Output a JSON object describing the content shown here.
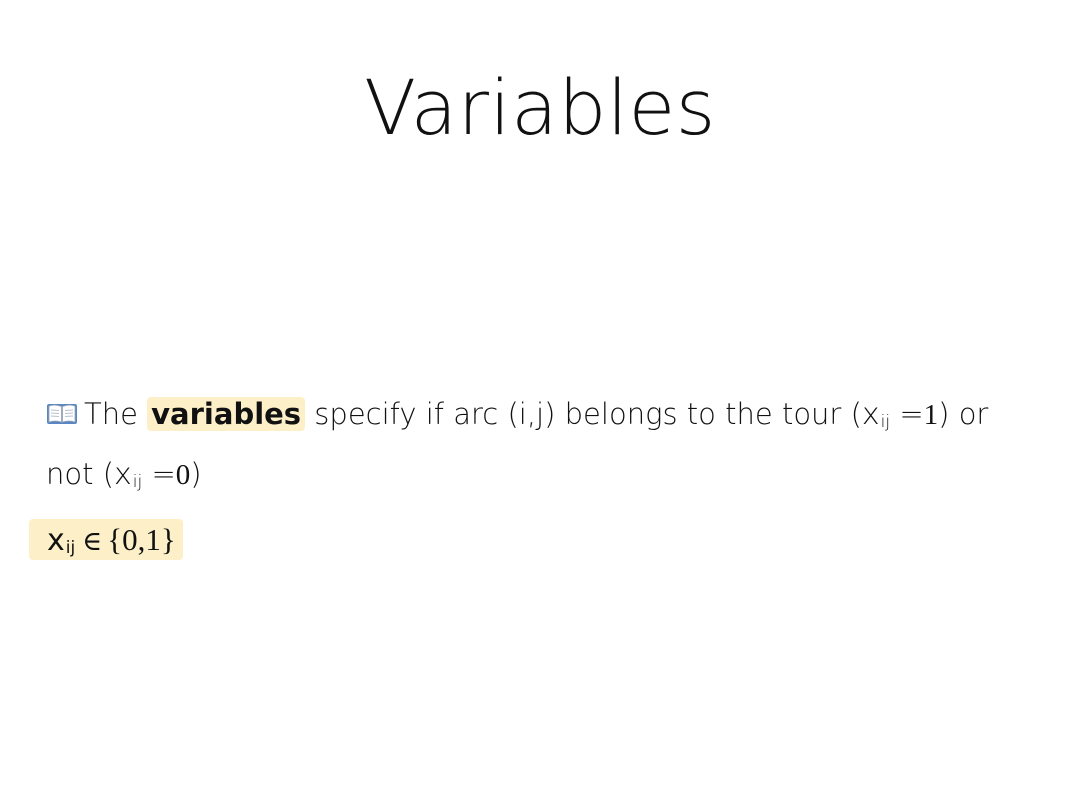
{
  "slide": {
    "title": "Variables",
    "statement": {
      "icon": "open-book-icon",
      "prefix": "The",
      "highlight": "variables",
      "part1": "specify if arc (",
      "arc_i": "i",
      "arc_comma": ",",
      "arc_j": "j",
      "part2": ") belongs to the tour (",
      "var1": "x",
      "sub1": "ij",
      "eq1": "=",
      "val1": "1",
      "part3": ") or not (",
      "var2": "x",
      "sub2": "ij",
      "eq2": "=",
      "val2": "0",
      "part4": ")"
    },
    "formula": {
      "var": "x",
      "sub": "ij",
      "op": "∈",
      "set": "{0,1}"
    }
  },
  "colors": {
    "highlight": "#fdf0c8",
    "text": "#111111",
    "background": "#ffffff"
  }
}
